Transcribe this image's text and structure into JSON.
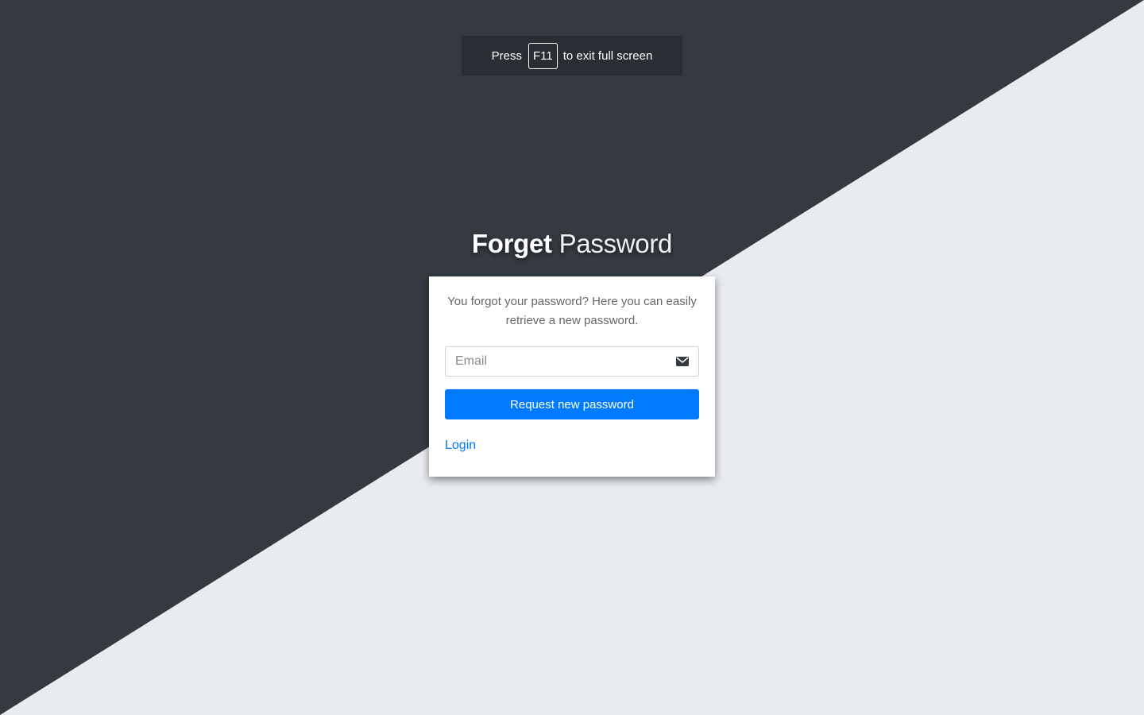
{
  "fullscreen_notice": {
    "prefix": "Press",
    "key": "F11",
    "suffix": "to exit full screen"
  },
  "brand": {
    "strong": "Forget",
    "light": "Password"
  },
  "card": {
    "message": "You forgot your password? Here you can easily retrieve a new password.",
    "email_placeholder": "Email",
    "email_icon": "envelope-icon",
    "submit_label": "Request new password",
    "login_link": "Login"
  },
  "colors": {
    "dark_bg": "#343a40",
    "light_bg": "#e9ecef",
    "primary": "#007bff"
  }
}
